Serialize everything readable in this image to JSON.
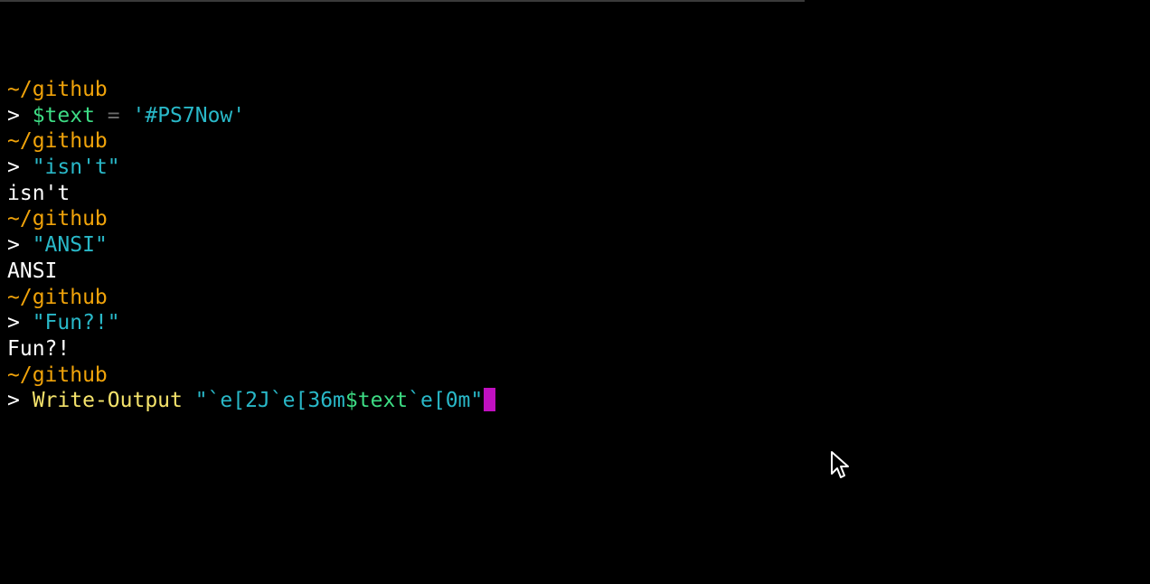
{
  "window_title": "",
  "colors": {
    "background": "#000000",
    "prompt_path": "#f0a30a",
    "prompt_symbol": "#ffffff",
    "variable": "#3ddc84",
    "operator": "#6a6a6a",
    "string": "#29b8c8",
    "command": "#f5e36b",
    "output": "#ffffff",
    "cursor": "#c010c0"
  },
  "terminal": {
    "lines": [
      {
        "kind": "path",
        "tokens": [
          {
            "t": "~/github",
            "c": "prompt_path"
          }
        ]
      },
      {
        "kind": "command",
        "tokens": [
          {
            "t": "> ",
            "c": "prompt_symbol"
          },
          {
            "t": "$text",
            "c": "variable"
          },
          {
            "t": " = ",
            "c": "operator"
          },
          {
            "t": "'#PS7Now'",
            "c": "string"
          }
        ]
      },
      {
        "kind": "path",
        "tokens": [
          {
            "t": "~/github",
            "c": "prompt_path"
          }
        ]
      },
      {
        "kind": "command",
        "tokens": [
          {
            "t": "> ",
            "c": "prompt_symbol"
          },
          {
            "t": "\"isn't\"",
            "c": "string"
          }
        ]
      },
      {
        "kind": "output",
        "tokens": [
          {
            "t": "isn't",
            "c": "output"
          }
        ]
      },
      {
        "kind": "path",
        "tokens": [
          {
            "t": "~/github",
            "c": "prompt_path"
          }
        ]
      },
      {
        "kind": "command",
        "tokens": [
          {
            "t": "> ",
            "c": "prompt_symbol"
          },
          {
            "t": "\"ANSI\"",
            "c": "string"
          }
        ]
      },
      {
        "kind": "output",
        "tokens": [
          {
            "t": "ANSI",
            "c": "output"
          }
        ]
      },
      {
        "kind": "path",
        "tokens": [
          {
            "t": "~/github",
            "c": "prompt_path"
          }
        ]
      },
      {
        "kind": "command",
        "tokens": [
          {
            "t": "> ",
            "c": "prompt_symbol"
          },
          {
            "t": "\"Fun?!\"",
            "c": "string"
          }
        ]
      },
      {
        "kind": "output",
        "tokens": [
          {
            "t": "Fun?!",
            "c": "output"
          }
        ]
      },
      {
        "kind": "path",
        "tokens": [
          {
            "t": "~/github",
            "c": "prompt_path"
          }
        ]
      },
      {
        "kind": "input",
        "tokens": [
          {
            "t": "> ",
            "c": "prompt_symbol"
          },
          {
            "t": "Write-Output",
            "c": "command"
          },
          {
            "t": " ",
            "c": "output"
          },
          {
            "t": "\"`e[2J`e[36m",
            "c": "string"
          },
          {
            "t": "$text",
            "c": "variable"
          },
          {
            "t": "`e[0m\"",
            "c": "string"
          }
        ],
        "cursor": true
      }
    ]
  },
  "icons": {
    "mouse_pointer": "mouse-pointer-icon"
  }
}
